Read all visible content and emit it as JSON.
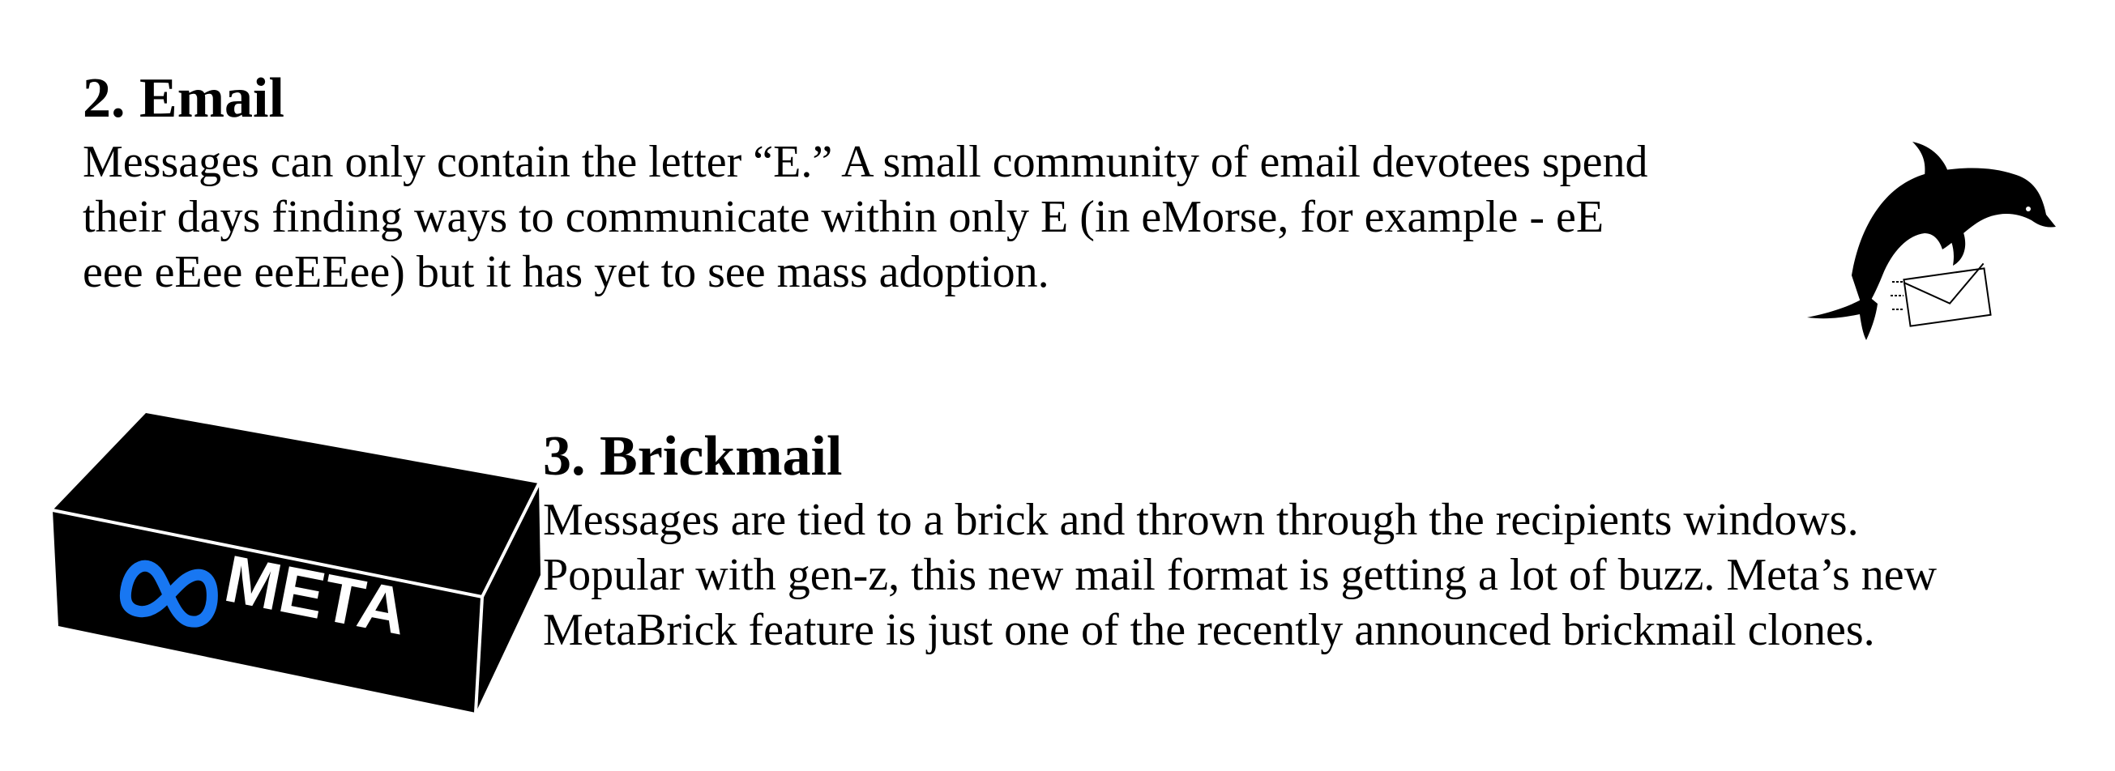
{
  "sections": [
    {
      "title": "2. Email",
      "body_lines": [
        "Messages can only contain the letter “E.” A small community of email devotees spend",
        "their days finding ways to communicate within only E (in eMorse, for example - eE",
        "eee eEee eeEEee) but it has yet to see mass adoption."
      ]
    },
    {
      "title": "3. Brickmail",
      "body_lines": [
        "Messages are tied to a brick and thrown through the recipients windows.",
        "Popular with gen-z, this new mail format is getting a lot of buzz. Meta’s new",
        "MetaBrick feature is just one of the recently announced brickmail clones."
      ]
    }
  ],
  "illustrations": {
    "dolphin": {
      "icon": "dolphin-with-envelope-icon",
      "color": "#000000"
    },
    "brick": {
      "icon": "meta-brick-icon",
      "brand_text": "META",
      "logo_color": "#1877F2",
      "brick_color": "#000000"
    }
  }
}
